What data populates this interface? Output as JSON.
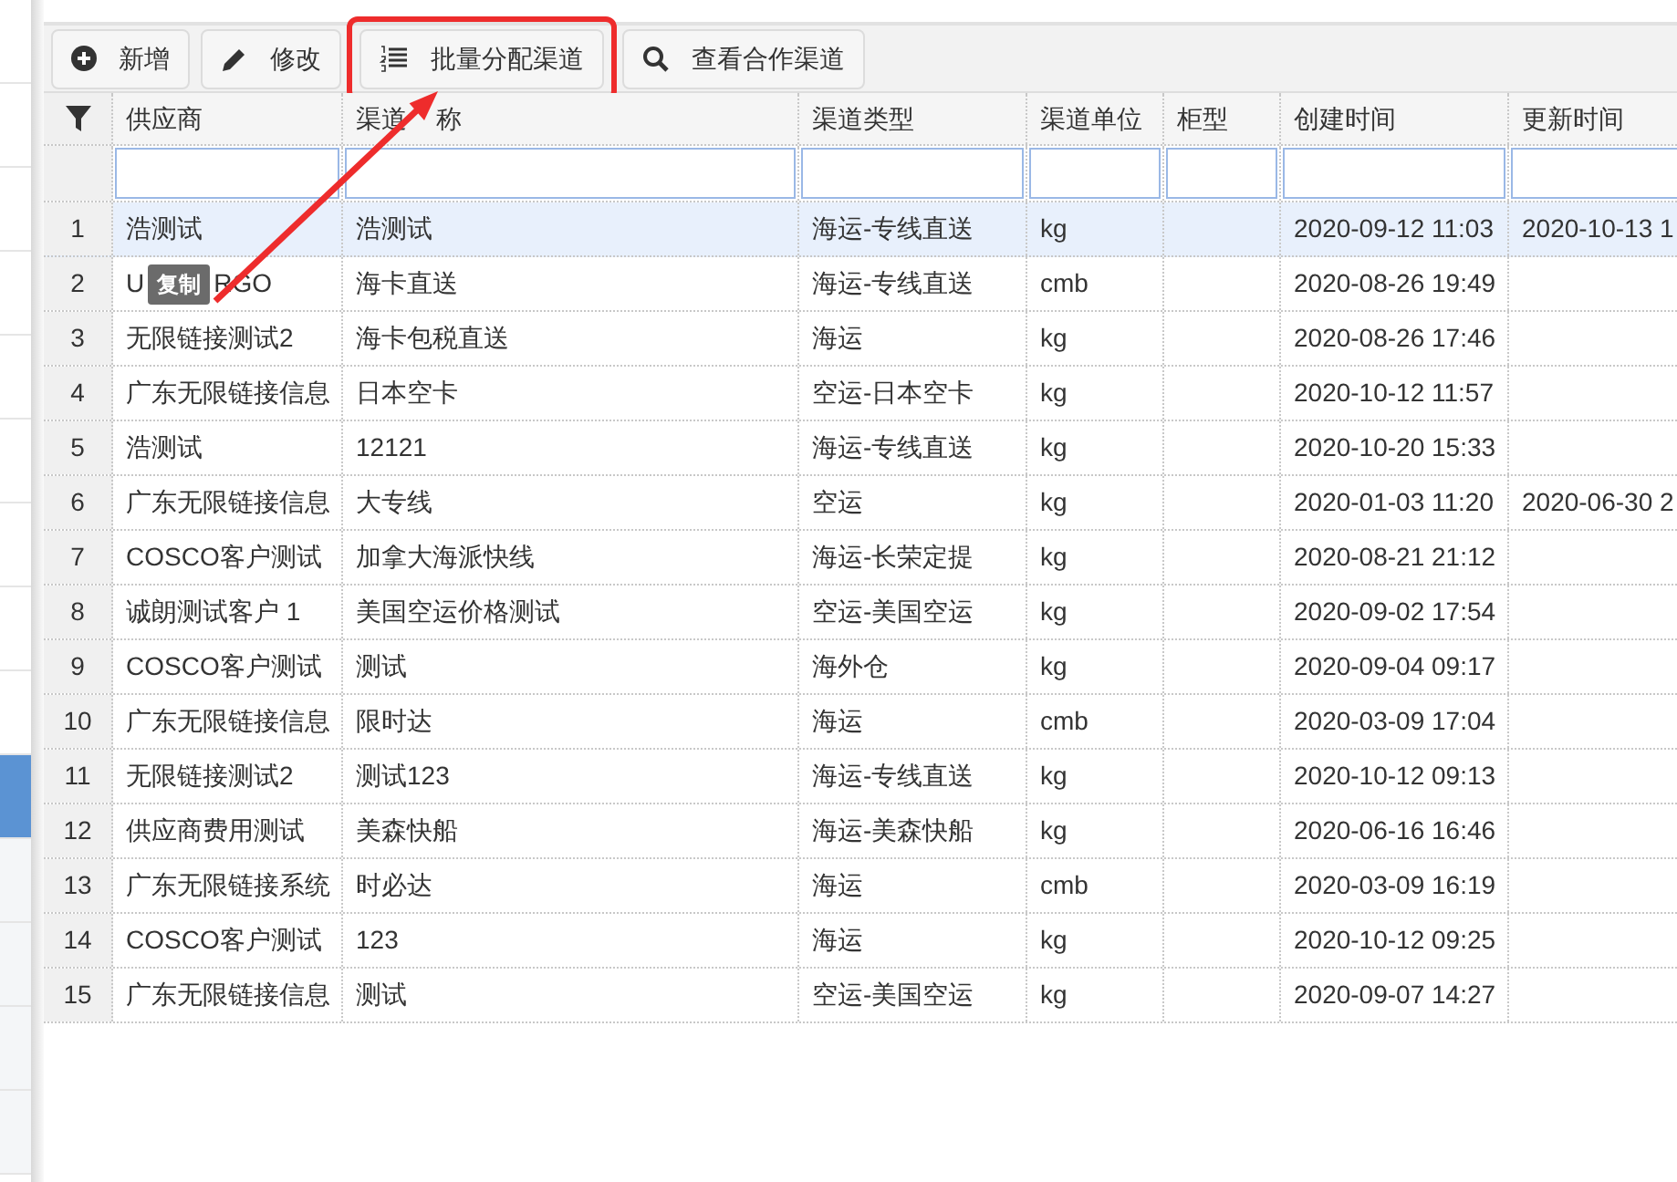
{
  "sidebar": {
    "items": [
      {
        "selected": false
      },
      {
        "selected": false
      },
      {
        "selected": false
      },
      {
        "selected": false
      },
      {
        "selected": false
      },
      {
        "selected": false
      },
      {
        "selected": false
      },
      {
        "selected": false
      },
      {
        "selected": false
      },
      {
        "selected": true
      },
      {
        "selected": false
      },
      {
        "selected": false
      },
      {
        "selected": false
      },
      {
        "selected": false
      }
    ]
  },
  "toolbar": {
    "buttons": [
      {
        "kind": "add",
        "label": "新增",
        "highlighted": false
      },
      {
        "kind": "edit",
        "label": "修改",
        "highlighted": false
      },
      {
        "kind": "batch",
        "label": "批量分配渠道",
        "highlighted": true
      },
      {
        "kind": "search",
        "label": "查看合作渠道",
        "highlighted": false
      }
    ]
  },
  "table": {
    "columns": [
      "供应商",
      [
        "渠道",
        "称"
      ],
      "渠道类型",
      "渠道单位",
      "柜型",
      "创建时间",
      "更新时间"
    ],
    "rows": [
      {
        "index": "1",
        "supplier": "浩测试",
        "name": "浩测试",
        "type": "海运-专线直送",
        "unit": "kg",
        "created": "2020-09-12 11:03",
        "updated": "2020-10-13 1",
        "selected": true
      },
      {
        "index": "2",
        "supplier": [
          "U",
          "RGO"
        ],
        "tooltip": "复制",
        "name": "海卡直送",
        "type": "海运-专线直送",
        "unit": "cmb",
        "created": "2020-08-26 19:49",
        "selected": false
      },
      {
        "index": "3",
        "supplier": "无限链接测试2",
        "name": "海卡包税直送",
        "type": "海运",
        "unit": "kg",
        "created": "2020-08-26 17:46",
        "selected": false
      },
      {
        "index": "4",
        "supplier": "广东无限链接信息",
        "name": "日本空卡",
        "type": "空运-日本空卡",
        "unit": "kg",
        "created": "2020-10-12 11:57",
        "selected": false
      },
      {
        "index": "5",
        "supplier": "浩测试",
        "name": "12121",
        "type": "海运-专线直送",
        "unit": "kg",
        "created": "2020-10-20 15:33",
        "selected": false
      },
      {
        "index": "6",
        "supplier": "广东无限链接信息",
        "name": "大专线",
        "type": "空运",
        "unit": "kg",
        "created": "2020-01-03 11:20",
        "updated": "2020-06-30 2",
        "selected": false
      },
      {
        "index": "7",
        "supplier": "COSCO客户测试",
        "name": "加拿大海派快线",
        "type": "海运-长荣定提",
        "unit": "kg",
        "created": "2020-08-21 21:12",
        "selected": false
      },
      {
        "index": "8",
        "supplier": "诚朗测试客户 1",
        "name": "美国空运价格测试",
        "type": "空运-美国空运",
        "unit": "kg",
        "created": "2020-09-02 17:54",
        "selected": false
      },
      {
        "index": "9",
        "supplier": "COSCO客户测试",
        "name": "测试",
        "type": "海外仓",
        "unit": "kg",
        "created": "2020-09-04 09:17",
        "selected": false
      },
      {
        "index": "10",
        "supplier": "广东无限链接信息",
        "name": "限时达",
        "type": "海运",
        "unit": "cmb",
        "created": "2020-03-09 17:04",
        "selected": false
      },
      {
        "index": "11",
        "supplier": "无限链接测试2",
        "name": "测试123",
        "type": "海运-专线直送",
        "unit": "kg",
        "created": "2020-10-12 09:13",
        "selected": false
      },
      {
        "index": "12",
        "supplier": "供应商费用测试",
        "name": "美森快船",
        "type": "海运-美森快船",
        "unit": "kg",
        "created": "2020-06-16 16:46",
        "selected": false
      },
      {
        "index": "13",
        "supplier": "广东无限链接系统",
        "name": "时必达",
        "type": "海运",
        "unit": "cmb",
        "created": "2020-03-09 16:19",
        "selected": false
      },
      {
        "index": "14",
        "supplier": "COSCO客户测试",
        "name": "123",
        "type": "海运",
        "unit": "kg",
        "created": "2020-10-12 09:25",
        "selected": false
      },
      {
        "index": "15",
        "supplier": "广东无限链接信息",
        "name": "测试",
        "type": "空运-美国空运",
        "unit": "kg",
        "created": "2020-09-07 14:27",
        "selected": false
      }
    ]
  }
}
